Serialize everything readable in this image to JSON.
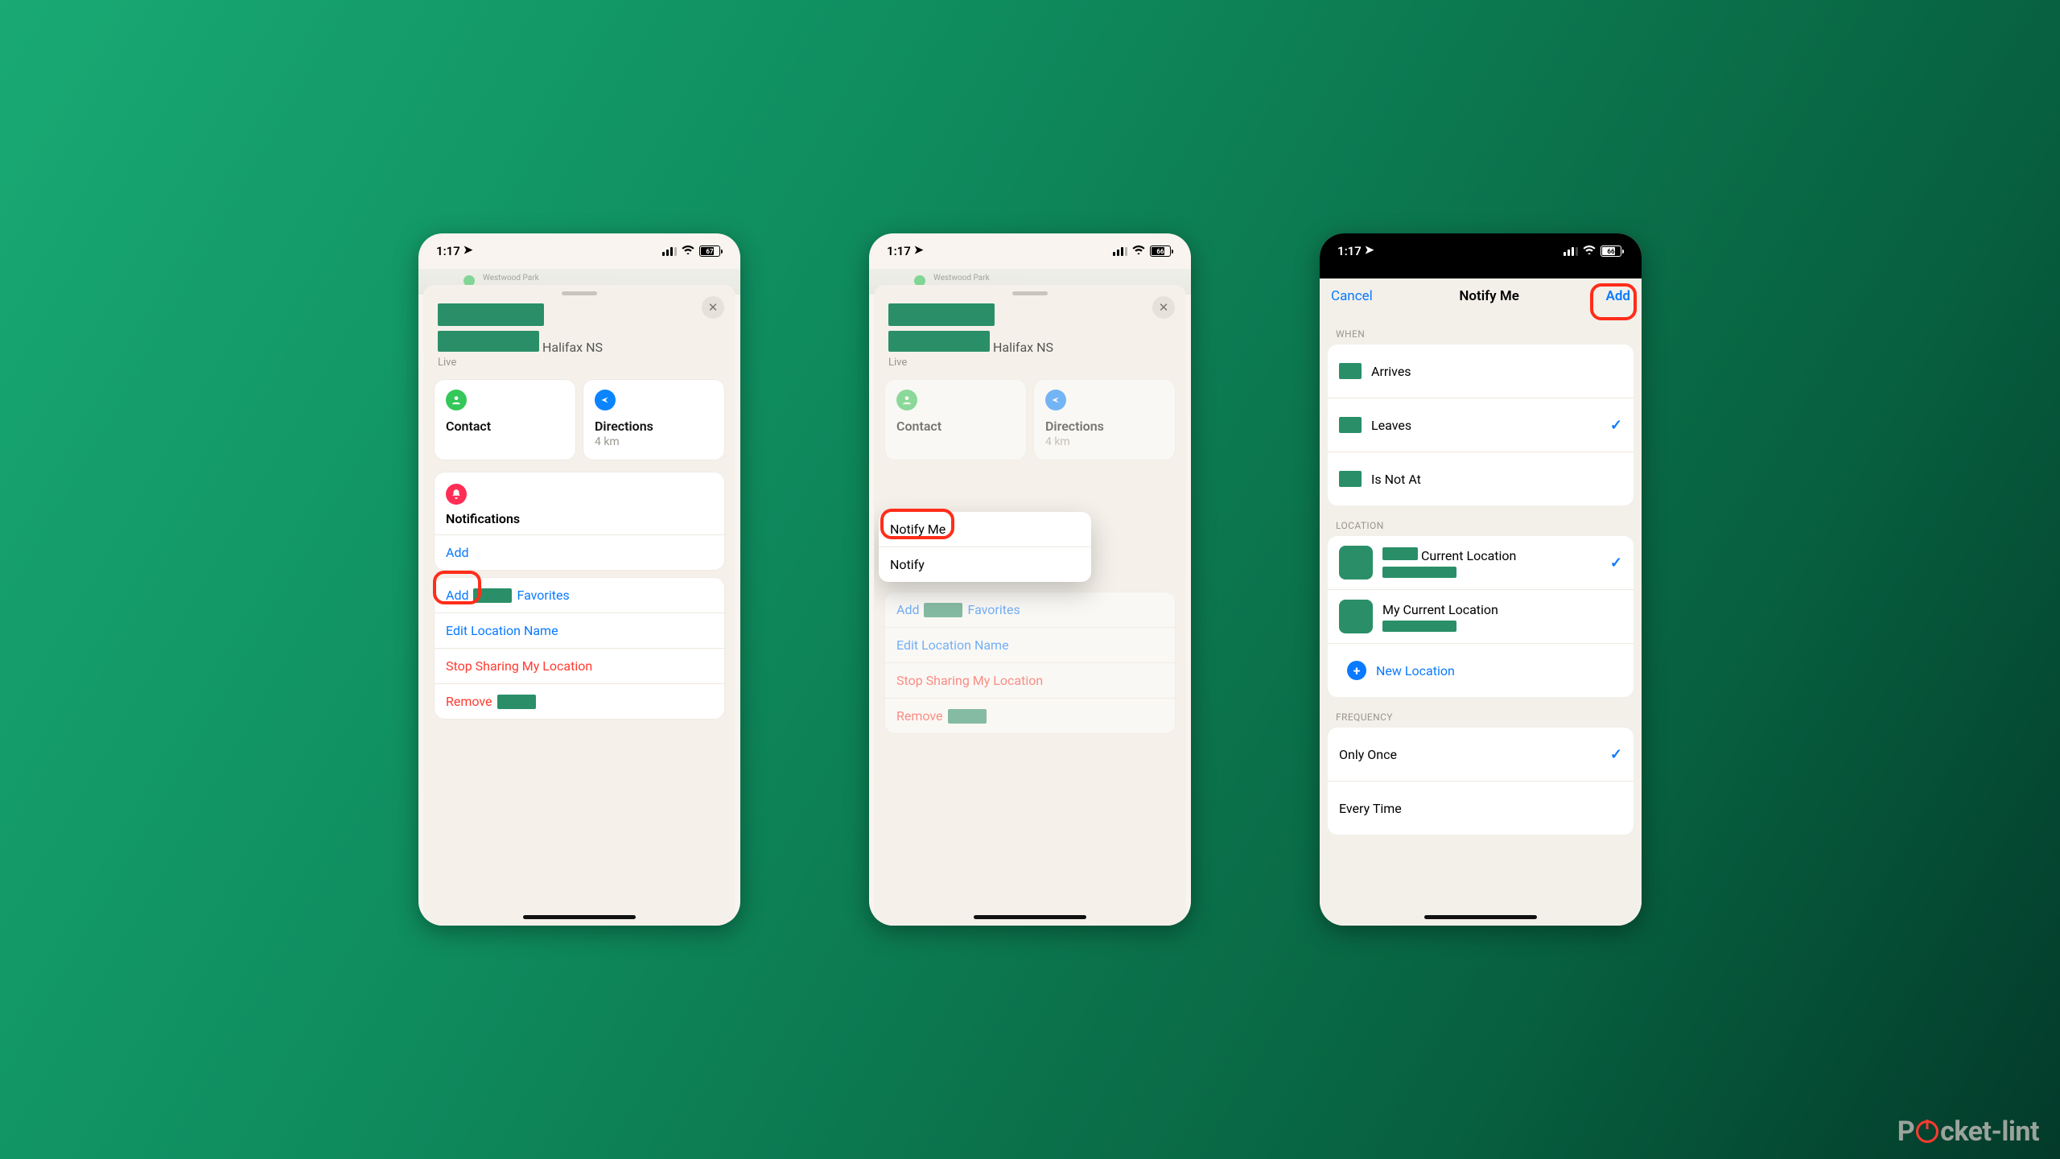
{
  "status": {
    "time": "1:17",
    "battery1": "67",
    "battery2": "66",
    "battery3": "66"
  },
  "common": {
    "place": "Halifax NS",
    "live": "Live",
    "contact": "Contact",
    "directions": "Directions",
    "distance": "4 km",
    "notifications": "Notifications",
    "add": "Add",
    "addFavPrefix": "Add",
    "addFavSuffix": "Favorites",
    "editLocation": "Edit Location Name",
    "stopSharing": "Stop Sharing My Location",
    "removePrefix": "Remove",
    "mapLabel": "Westwood Park"
  },
  "menu": {
    "notifyMe": "Notify Me",
    "notifyPrefix": "Notify",
    "add": "Add"
  },
  "p3": {
    "cancel": "Cancel",
    "title": "Notify Me",
    "add": "Add",
    "whenLabel": "WHEN",
    "when": {
      "arrives": "Arrives",
      "leaves": "Leaves",
      "isNotAt": "Is Not At"
    },
    "locationLabel": "LOCATION",
    "loc": {
      "currentSuffix": "Current Location",
      "myCurrent": "My Current Location",
      "newLocation": "New Location"
    },
    "frequencyLabel": "FREQUENCY",
    "freq": {
      "once": "Only Once",
      "every": "Every Time"
    }
  },
  "watermark": {
    "left": "P",
    "right": "cket-lint"
  }
}
